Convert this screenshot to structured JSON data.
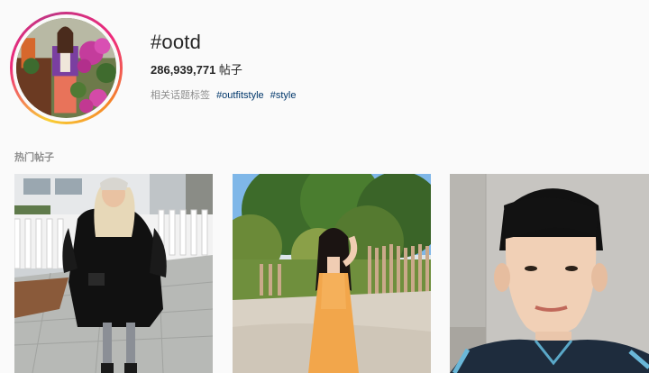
{
  "hashtag": {
    "title": "#ootd",
    "post_count": "286,939,771",
    "post_count_unit": " 帖子"
  },
  "related": {
    "label": "相关话题标签",
    "tags": [
      "#outfitstyle",
      "#style"
    ]
  },
  "top_posts": {
    "label": "热门帖子"
  }
}
